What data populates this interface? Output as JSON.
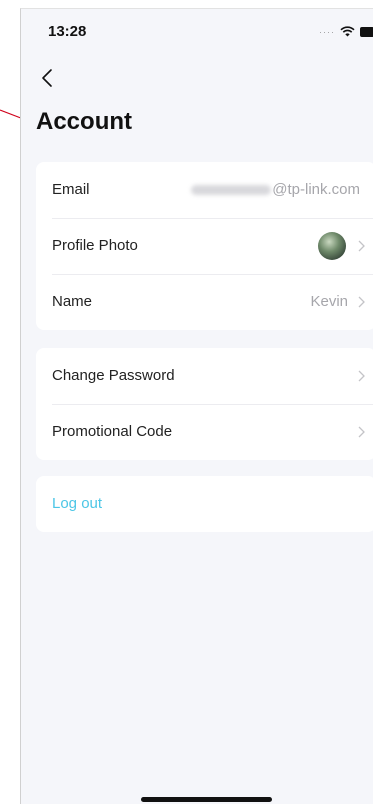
{
  "status_bar": {
    "time": "13:28"
  },
  "header": {
    "title": "Account"
  },
  "account_info": {
    "email_label": "Email",
    "email_value": "@tp-link.com",
    "profile_photo_label": "Profile Photo",
    "name_label": "Name",
    "name_value": "Kevin"
  },
  "security": {
    "change_password_label": "Change Password",
    "promotional_code_label": "Promotional Code"
  },
  "logout": {
    "label": "Log out"
  },
  "colors": {
    "accent": "#4cc6e6",
    "annotation": "#d0021b"
  },
  "icons": [
    "back-chevron-icon",
    "chevron-right-icon",
    "wifi-icon",
    "battery-icon",
    "cellular-signal-icon"
  ]
}
